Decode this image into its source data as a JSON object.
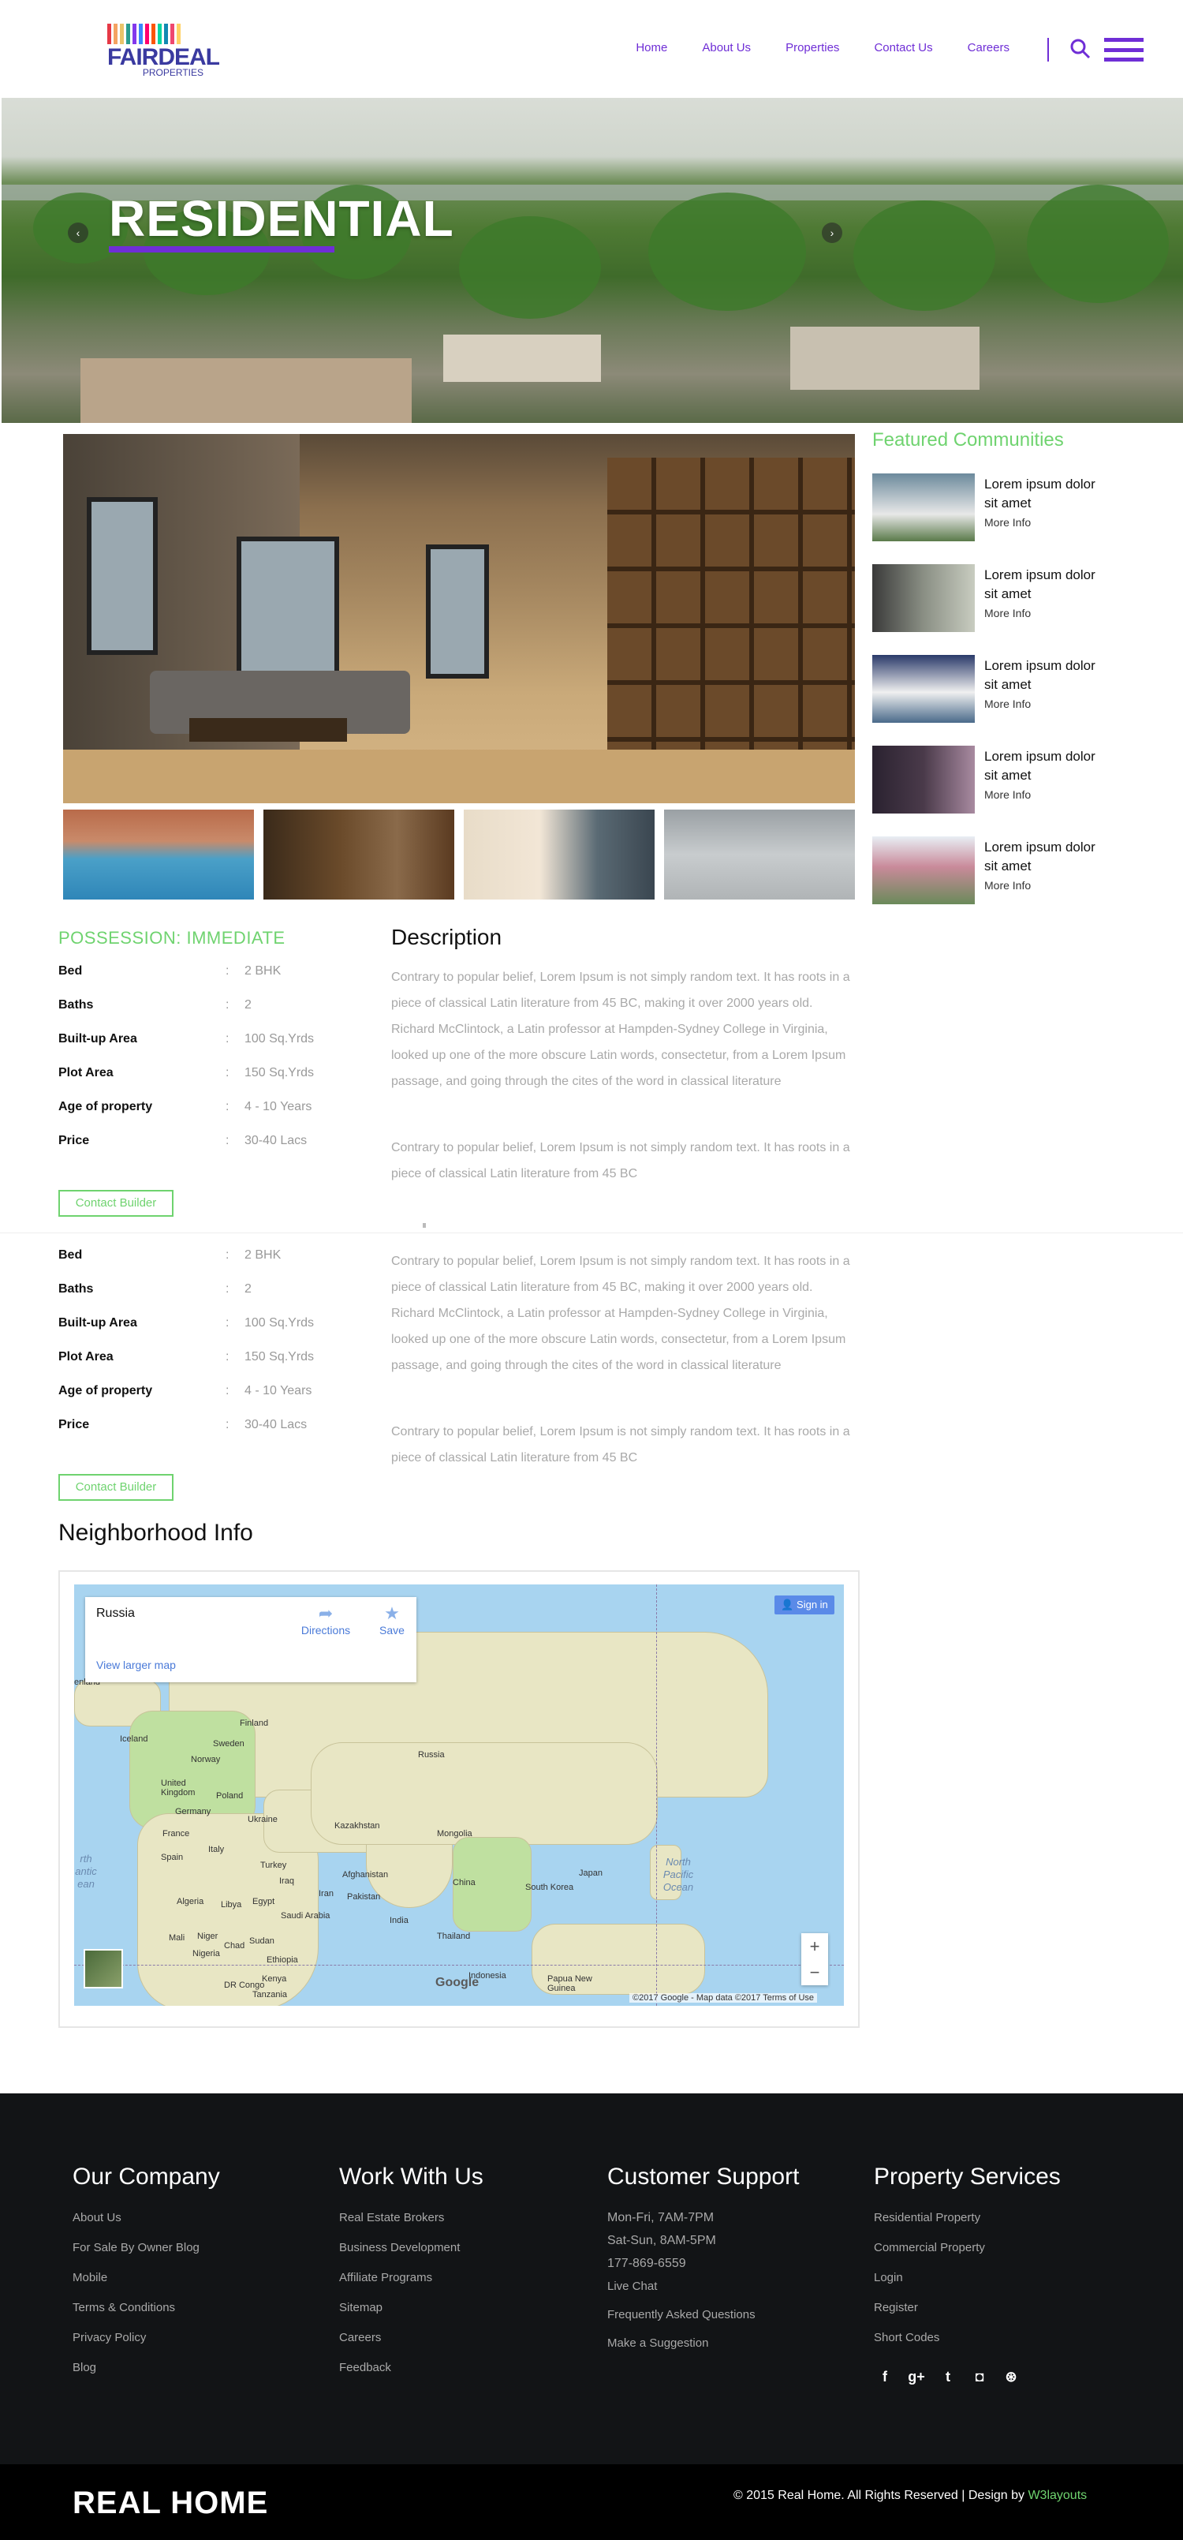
{
  "brand": {
    "name": "FAIRDEAL",
    "subtitle": "PROPERTIES",
    "bar_colors": [
      "#e63946",
      "#f4a261",
      "#e9c46a",
      "#2a9d8f",
      "#8338ec",
      "#3a86ff",
      "#ff006e",
      "#fb5607",
      "#06d6a0",
      "#118ab2",
      "#ef476f",
      "#ffd166"
    ]
  },
  "nav": {
    "items": [
      "Home",
      "About Us",
      "Properties",
      "Contact Us",
      "Careers"
    ]
  },
  "banner": {
    "title": "RESIDENTIAL"
  },
  "featured": {
    "title": "Featured Communities",
    "items": [
      {
        "title": "Lorem ipsum dolor sit amet",
        "more": "More Info",
        "color": "#6c8a9c"
      },
      {
        "title": "Lorem ipsum dolor sit amet",
        "more": "More Info",
        "color": "#8a8f84"
      },
      {
        "title": "Lorem ipsum dolor sit amet",
        "more": "More Info",
        "color": "#2a3a6a"
      },
      {
        "title": "Lorem ipsum dolor sit amet",
        "more": "More Info",
        "color": "#4a3a4a"
      },
      {
        "title": "Lorem ipsum dolor sit amet",
        "more": "More Info",
        "color": "#c98a9a"
      }
    ]
  },
  "details": {
    "possession": "POSSESSION: IMMEDIATE",
    "rows": [
      {
        "label": "Bed",
        "value": "2 BHK"
      },
      {
        "label": "Baths",
        "value": "2"
      },
      {
        "label": "Built-up Area",
        "value": "100 Sq.Yrds"
      },
      {
        "label": "Plot Area",
        "value": "150 Sq.Yrds"
      },
      {
        "label": "Age of property",
        "value": "4 - 10 Years"
      },
      {
        "label": "Price",
        "value": "30-40 Lacs"
      }
    ],
    "contact_label": "Contact Builder"
  },
  "description": {
    "title": "Description",
    "para1": "Contrary to popular belief, Lorem Ipsum is not simply random text. It has roots in a piece of classical Latin literature from 45 BC, making it over 2000 years old. Richard McClintock, a Latin professor at Hampden-Sydney College in Virginia, looked up one of the more obscure Latin words, consectetur, from a Lorem Ipsum passage, and going through the cites of the word in classical literature",
    "para2": "Contrary to popular belief, Lorem Ipsum is not simply random text. It has roots in a piece of classical Latin literature from 45 BC"
  },
  "neighborhood": {
    "title": "Neighborhood Info",
    "map": {
      "place": "Russia",
      "directions": "Directions",
      "save": "Save",
      "view_larger": "View larger map",
      "sign_in": "Sign in",
      "google": "Google",
      "attribution": "©2017 Google - Map data ©2017    Terms of Use",
      "labels": {
        "russia": "Russia",
        "finland": "Finland",
        "sweden": "Sweden",
        "norway": "Norway",
        "iceland": "Iceland",
        "uk": "United Kingdom",
        "france": "France",
        "spain": "Spain",
        "germany": "Germany",
        "poland": "Poland",
        "ukraine": "Ukraine",
        "italy": "Italy",
        "turkey": "Turkey",
        "kazakhstan": "Kazakhstan",
        "mongolia": "Mongolia",
        "china": "China",
        "iran": "Iran",
        "iraq": "Iraq",
        "afghanistan": "Afghanistan",
        "pakistan": "Pakistan",
        "india": "India",
        "thailand": "Thailand",
        "japan": "Japan",
        "south_korea": "South Korea",
        "algeria": "Algeria",
        "libya": "Libya",
        "egypt": "Egypt",
        "saudi": "Saudi Arabia",
        "mali": "Mali",
        "niger": "Niger",
        "chad": "Chad",
        "sudan": "Sudan",
        "nigeria": "Nigeria",
        "ethiopia": "Ethiopia",
        "kenya": "Kenya",
        "drc": "DR Congo",
        "tanzania": "Tanzania",
        "indonesia": "Indonesia",
        "png": "Papua New Guinea",
        "greenland": "enland",
        "north_pacific": "North Pacific Ocean",
        "north_atlantic": "rth antic ean"
      }
    }
  },
  "footer": {
    "company": {
      "title": "Our Company",
      "links": [
        "About Us",
        "For Sale By Owner Blog",
        "Mobile",
        "Terms & Conditions",
        "Privacy Policy",
        "Blog"
      ]
    },
    "work": {
      "title": "Work With Us",
      "links": [
        "Real Estate Brokers",
        "Business Development",
        "Affiliate Programs",
        "Sitemap",
        "Careers",
        "Feedback"
      ]
    },
    "support": {
      "title": "Customer Support",
      "hours1": "Mon-Fri, 7AM-7PM",
      "hours2": "Sat-Sun, 8AM-5PM",
      "phone": "177-869-6559",
      "links": [
        "Live Chat",
        "Frequently Asked Questions",
        "Make a Suggestion"
      ]
    },
    "services": {
      "title": "Property Services",
      "links": [
        "Residential Property",
        "Commercial Property",
        "Login",
        "Register",
        "Short Codes"
      ]
    },
    "social": [
      "facebook-icon",
      "google-plus-icon",
      "twitter-icon",
      "instagram-icon",
      "dribbble-icon"
    ],
    "brand": "REAL HOME",
    "copyright": "© 2015 Real Home. All Rights Reserved | Design by ",
    "designer": "W3layouts"
  }
}
